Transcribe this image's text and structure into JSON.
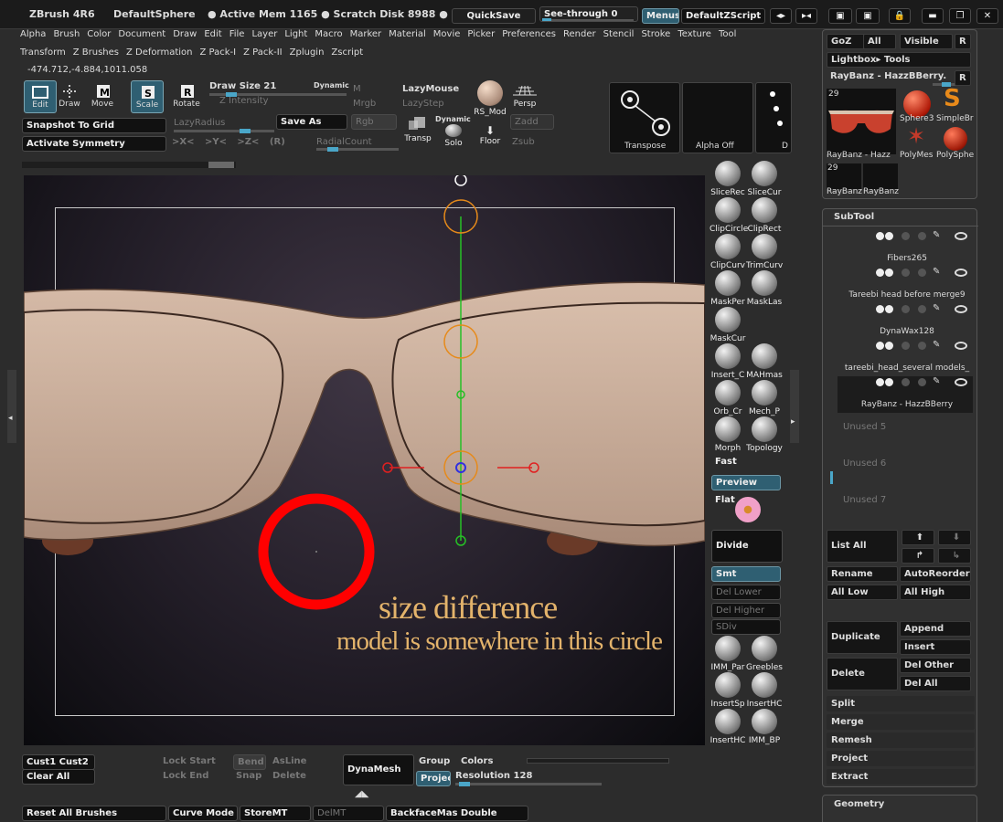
{
  "title": {
    "app": "ZBrush 4R6",
    "doc": "DefaultSphere",
    "mem": "● Active Mem 1165 ● Scratch Disk 8988 ● F",
    "quicksave": "QuickSave",
    "seethrough": "See-through 0",
    "menus": "Menus",
    "zscript": "DefaultZScript"
  },
  "menubar": [
    "Alpha",
    "Brush",
    "Color",
    "Document",
    "Draw",
    "Edit",
    "File",
    "Layer",
    "Light",
    "Macro",
    "Marker",
    "Material",
    "Movie",
    "Picker",
    "Preferences",
    "Render",
    "Stencil",
    "Stroke",
    "Texture",
    "Tool"
  ],
  "menubar2": [
    "Transform",
    "Z Brushes",
    "Z Deformation",
    "Z Pack-I",
    "Z Pack-II",
    "Zplugin",
    "Zscript"
  ],
  "coords": "-474.712,-4.884,1011.058",
  "toolbar": {
    "edit": "Edit",
    "draw": "Draw",
    "move": "Move",
    "scale": "Scale",
    "rotate": "Rotate",
    "snapshot": "Snapshot To Grid",
    "symmetry": "Activate Symmetry",
    "drawsize": "Draw Size 21",
    "dynamic": "Dynamic",
    "intensity": "Z Intensity",
    "lazyradius": "LazyRadius",
    "saveas": "Save As",
    "axes": ">X< >Y< >Z< (R)",
    "m": "M",
    "mrgb": "Mrgb",
    "rgb": "Rgb",
    "lazymouse": "LazyMouse",
    "lazystep": "LazyStep",
    "radialcount": "RadialCount",
    "rsmod": "RS_Mod",
    "persp": "Persp",
    "transp": "Transp",
    "dynamic2": "Dynamic",
    "solo": "Solo",
    "floor": "Floor",
    "zadd": "Zadd",
    "zsub": "Zsub",
    "transpose": "Transpose",
    "alphaoff": "Alpha Off",
    "d": "D"
  },
  "viewport": {
    "annotation1": "size difference",
    "annotation2": "model is somewhere in this circle"
  },
  "colors": {
    "accent": "#2f5f72",
    "annotation": "#ff0000",
    "text_gold": "#e3b36b",
    "frame": "#d1b39f"
  },
  "shelf": [
    [
      "SliceRec",
      "SliceCur"
    ],
    [
      "ClipCircle",
      "ClipRect"
    ],
    [
      "ClipCurv",
      "TrimCurv"
    ],
    [
      "MaskPer",
      "MaskLas"
    ],
    [
      "MaskCur",
      ""
    ],
    [
      "Insert_C",
      "MAHmas"
    ],
    [
      "Orb_Cr",
      "Mech_P"
    ],
    [
      "Morph",
      "Topology"
    ],
    [
      "IMM_Par",
      "Greebles"
    ],
    [
      "InsertSp",
      "InsertHC"
    ],
    [
      "InsertHC",
      "IMM_BP"
    ]
  ],
  "shelfbtn": {
    "fast": "Fast",
    "preview": "Preview",
    "flat": "Flat",
    "divide": "Divide",
    "smt": "Smt",
    "dellower": "Del Lower",
    "delhigher": "Del Higher",
    "sdiv": "SDiv"
  },
  "rightpanel": {
    "goz": "GoZ",
    "all": "All",
    "visible": "Visible",
    "r": "R",
    "lightbox": "Lightbox▸ Tools",
    "toolname": "RayBanz - HazzBBerry.",
    "num": "29",
    "num2": "29",
    "thumbs": [
      "RayBanz - Hazz",
      "Sphere3",
      "SimpleBr",
      "PolyMes",
      "PolySphe",
      "RayBanz",
      "RayBanz"
    ],
    "subtool": "SubTool",
    "subtools": [
      "Fibers265",
      "Tareebi head before merge9",
      "DynaWax128",
      "tareebi_head_several models_",
      "RayBanz - HazzBBerry"
    ],
    "unused": [
      "Unused 5",
      "Unused 6",
      "Unused 7"
    ],
    "listall": "List All",
    "rename": "Rename",
    "autoreorder": "AutoReorder",
    "alllow": "All Low",
    "allhigh": "All High",
    "duplicate": "Duplicate",
    "append": "Append",
    "insert": "Insert",
    "delete": "Delete",
    "delother": "Del Other",
    "delall": "Del All",
    "split": "Split",
    "merge": "Merge",
    "remesh": "Remesh",
    "project": "Project",
    "extract": "Extract",
    "geometry": "Geometry"
  },
  "bottom": {
    "cust": "Cust1 Cust2",
    "clearall": "Clear All",
    "lockstart": "Lock Start",
    "lockend": "Lock End",
    "bend": "Bend",
    "snap": "Snap",
    "asline": "AsLine",
    "delete": "Delete",
    "dynamesh": "DynaMesh",
    "group": "Group",
    "colors": "Colors",
    "project": "Projec",
    "resolution": "Resolution 128",
    "resetall": "Reset All Brushes",
    "curvemode": "Curve Mode",
    "storemt": "StoreMT",
    "delmt": "DelMT",
    "backface": "BackfaceMas Double"
  }
}
